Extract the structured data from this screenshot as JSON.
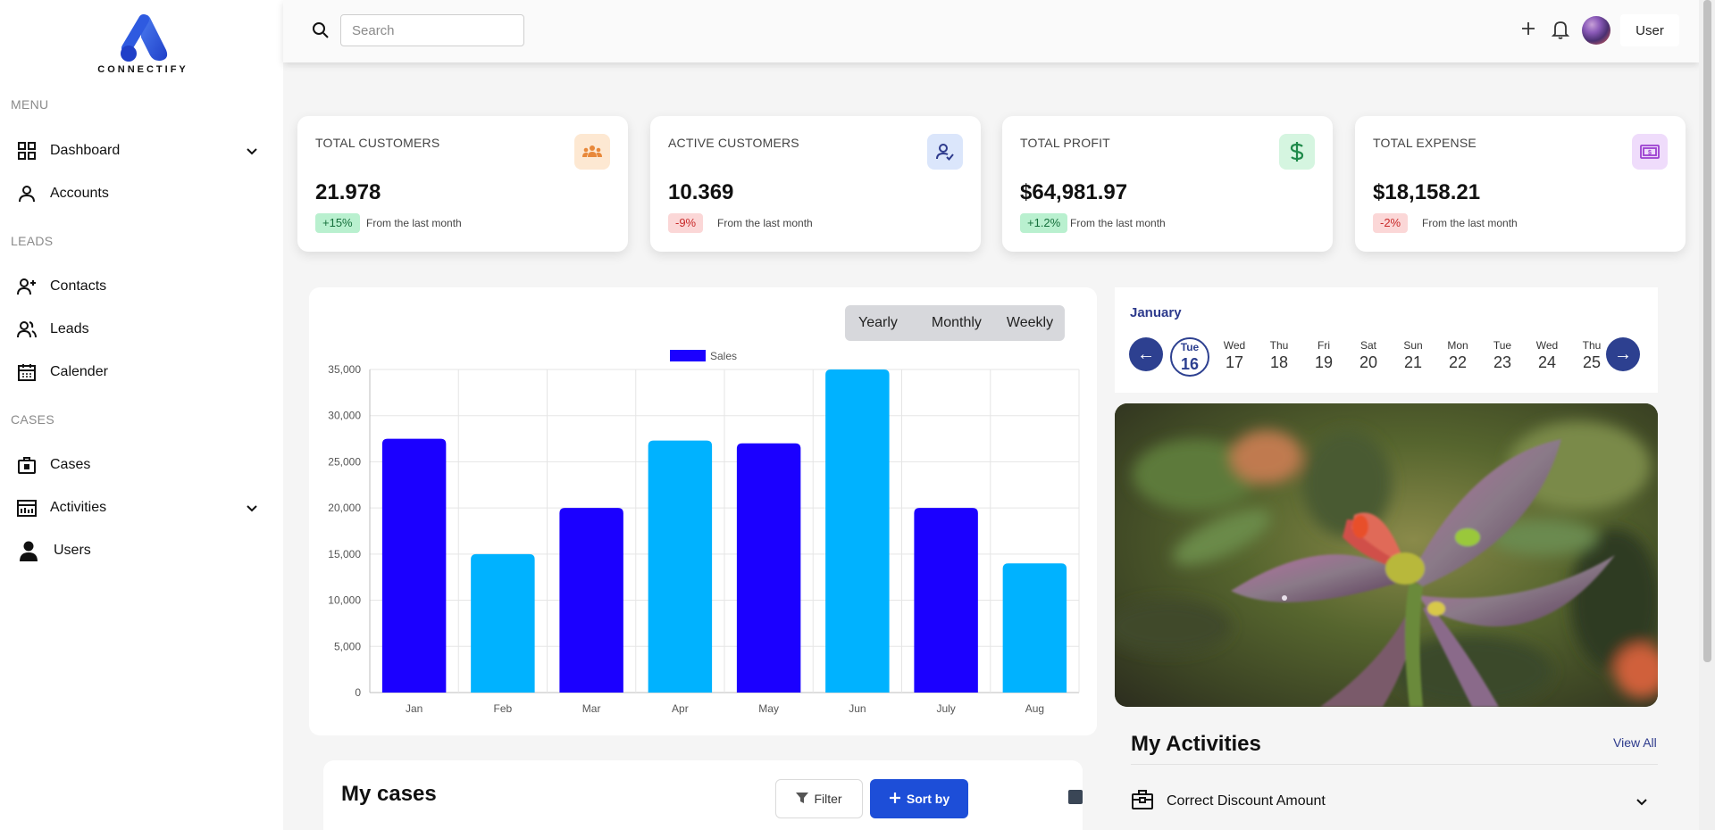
{
  "app": {
    "brand_name": "CONNECTIFY"
  },
  "sidebar": {
    "sections": {
      "menu": "MENU",
      "leads": "LEADS",
      "cases": "CASES"
    },
    "items": [
      {
        "label": "Dashboard",
        "icon": "grid-icon",
        "has_chevron": true
      },
      {
        "label": "Accounts",
        "icon": "user-icon",
        "has_chevron": false
      },
      {
        "label": "Contacts",
        "icon": "user-plus-icon",
        "has_chevron": false
      },
      {
        "label": "Leads",
        "icon": "users-icon",
        "has_chevron": false
      },
      {
        "label": "Calender",
        "icon": "calendar-icon",
        "has_chevron": false
      },
      {
        "label": "Cases",
        "icon": "briefcase-icon",
        "has_chevron": false
      },
      {
        "label": "Activities",
        "icon": "activity-icon",
        "has_chevron": true
      },
      {
        "label": "Users",
        "icon": "person-icon",
        "has_chevron": false
      }
    ]
  },
  "topbar": {
    "search_placeholder": "Search",
    "user_label": "User"
  },
  "stats": [
    {
      "title": "TOTAL CUSTOMERS",
      "value": "21.978",
      "change": "+15%",
      "trend": "up",
      "note": "From the last month",
      "icon": "team-icon",
      "icon_bg": "#fde8d2",
      "icon_color": "#e8883a"
    },
    {
      "title": "ACTIVE CUSTOMERS",
      "value": "10.369",
      "change": "-9%",
      "trend": "down",
      "note": "From the last month",
      "icon": "user-check-icon",
      "icon_bg": "#dbe6fb",
      "icon_color": "#2d3a8c"
    },
    {
      "title": "TOTAL PROFIT",
      "value": "$64,981.97",
      "change": "+1.2%",
      "trend": "up",
      "note": "From the last month",
      "icon": "dollar-icon",
      "icon_bg": "#d5f5e0",
      "icon_color": "#1f8a4a"
    },
    {
      "title": "TOTAL EXPENSE",
      "value": "$18,158.21",
      "change": "-2%",
      "trend": "down",
      "note": "From the last month",
      "icon": "banknote-icon",
      "icon_bg": "#efdcfb",
      "icon_color": "#9b3fd0"
    }
  ],
  "chart_tabs": [
    "Yearly",
    "Monthly",
    "Weekly"
  ],
  "chart_data": {
    "type": "bar",
    "categories": [
      "Jan",
      "Feb",
      "Mar",
      "Apr",
      "May",
      "Jun",
      "July",
      "Aug"
    ],
    "series": [
      {
        "name": "Sales",
        "values": [
          27500,
          15000,
          20000,
          27300,
          27000,
          35000,
          20000,
          14000
        ]
      }
    ],
    "bar_colors": [
      "#1b00ff",
      "#00b2ff",
      "#1b00ff",
      "#00b2ff",
      "#1b00ff",
      "#00b2ff",
      "#1b00ff",
      "#00b2ff"
    ],
    "ylim": [
      0,
      35000
    ],
    "yticks": [
      "0",
      "5,000",
      "10,000",
      "15,000",
      "20,000",
      "25,000",
      "30,000",
      "35,000"
    ],
    "grid": true,
    "legend": "top"
  },
  "calendar": {
    "month": "January",
    "prev_label": "←",
    "next_label": "→",
    "days": [
      {
        "dow": "Tue",
        "num": "16",
        "selected": true
      },
      {
        "dow": "Wed",
        "num": "17"
      },
      {
        "dow": "Thu",
        "num": "18"
      },
      {
        "dow": "Fri",
        "num": "19"
      },
      {
        "dow": "Sat",
        "num": "20"
      },
      {
        "dow": "Sun",
        "num": "21"
      },
      {
        "dow": "Mon",
        "num": "22"
      },
      {
        "dow": "Tue",
        "num": "23"
      },
      {
        "dow": "Wed",
        "num": "24"
      },
      {
        "dow": "Thu",
        "num": "25"
      }
    ]
  },
  "activities": {
    "title": "My Activities",
    "view_all": "View All",
    "items": [
      {
        "label": "Correct Discount Amount"
      }
    ]
  },
  "cases": {
    "title": "My cases",
    "filter_label": "Filter",
    "sort_label": "Sort by"
  }
}
